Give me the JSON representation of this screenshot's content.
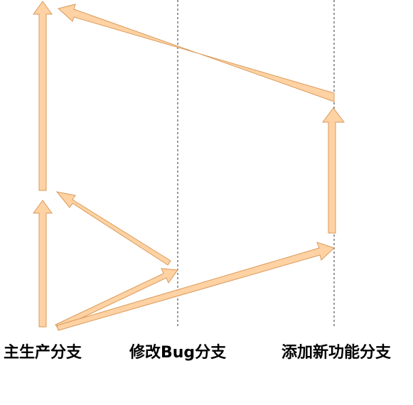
{
  "diagram": {
    "labels": {
      "main_branch": "主生产分支",
      "bugfix_branch": "修改Bug分支",
      "feature_branch": "添加新功能分支"
    },
    "colors": {
      "arrow_fill": "#ffd2a3",
      "arrow_stroke": "#d99a5b",
      "lane_line": "#333333",
      "label_text": "#000000"
    }
  }
}
